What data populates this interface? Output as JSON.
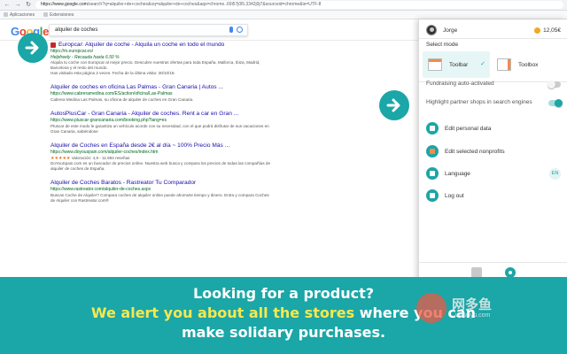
{
  "browser": {
    "url_host": "https://www.google.com",
    "url_rest": "/search?q=alquiler+de+coches&oq=alquiler+de+coches&aqs=chrome..69i57j0l5.3342j0j7&sourceid=chrome&ie=UTF-8",
    "bookmarks": [
      "Aplicaciones",
      "Extensiones"
    ]
  },
  "google": {
    "search_query": "alquiler de coches"
  },
  "results": [
    {
      "title": "Europcar: Alquiler de coche - Alquila un coche en todo el mundo",
      "url": "https://m.europcar.es/",
      "sub": "Helpfreely - Recauda hasta 6.50 %",
      "snippet": "Alquila tu coche con Europcar al mejor precio. Descubre nuestras ofertas para toda España, Mallorca, Ibiza, Madrid, Barcelona y el resto del mundo.",
      "note": "Has visitado esta página 2 veces. Fecha de la última visita: 30/10/18."
    },
    {
      "title": "Alquiler de coches en oficina Las Palmas - Gran Canaria | Autos ...",
      "url": "https://www.cabreramedina.com/ES/action/oficina/Las-Palmas",
      "snippet": "Cabrera Medina Las Palmas, su oficina de alquiler de coches en Gran Canaria."
    },
    {
      "title": "AutosPlusCar - Gran Canaria - Alquiler de coches. Rent a car en Gran ...",
      "url": "https://www.pluscar-grancanaria.com/booking.php?lang=es",
      "snippet": "Pluscar de este modo le garantiza un vehículo acorde con su necesidad, con el que podrá disfrutar de sus vacaciones en Gran Canaria, sabiéndose"
    },
    {
      "title": "Alquiler de Coches en España desde 2€ al día ~ 100% Precio Más ...",
      "url": "https://www.doyouspain.com/alquiler-coches/index.htm",
      "rating": "Valoración: 4,9 - 11.994 reseñas",
      "snippet": "DoYouSpain.com es un buscador de precios online. Nuestra web busca y compara los precios de todas las compañías de alquiler de coches de España."
    },
    {
      "title": "Alquiler de Coches Baratos - Rastreator Tu Comparador",
      "url": "https://www.rastreator.com/alquiler-de-coches.aspx",
      "snippet": "Buscas Coche de Alquiler? Compara coches de alquiler online puede ahorrarte tiempo y dinero. Entra y compara Coches de Alquiler con Rastreator.com®"
    }
  ],
  "popup": {
    "user_name": "Jorge",
    "balance": "12,05€",
    "select_mode_label": "Select mode",
    "modes": [
      {
        "label": "Toolbar",
        "selected": true
      },
      {
        "label": "Toolbox",
        "selected": false
      }
    ],
    "toggles": [
      {
        "label": "Fundraising auto-activated",
        "on": false
      },
      {
        "label": "Highlight partner shops in search engines",
        "on": true
      }
    ],
    "menu": [
      {
        "label": "Edit personal data",
        "icon": "user-icon"
      },
      {
        "label": "Edit selected nonprofits",
        "icon": "home-icon"
      },
      {
        "label": "Language",
        "icon": "globe-icon",
        "badge": "EN"
      },
      {
        "label": "Log out",
        "icon": "logout-icon"
      }
    ]
  },
  "banner": {
    "line1": "Looking for a product?",
    "line2_highlight": "We alert you about all the stores",
    "line2_rest": " where you can",
    "line3": "make solidary purchases."
  },
  "watermark": {
    "text": "网多鱼",
    "domain": "wduoyu.com"
  },
  "colors": {
    "accent": "#1ba6a7",
    "highlight": "#f6e84f",
    "link": "#1a0dab",
    "url_green": "#006621"
  }
}
